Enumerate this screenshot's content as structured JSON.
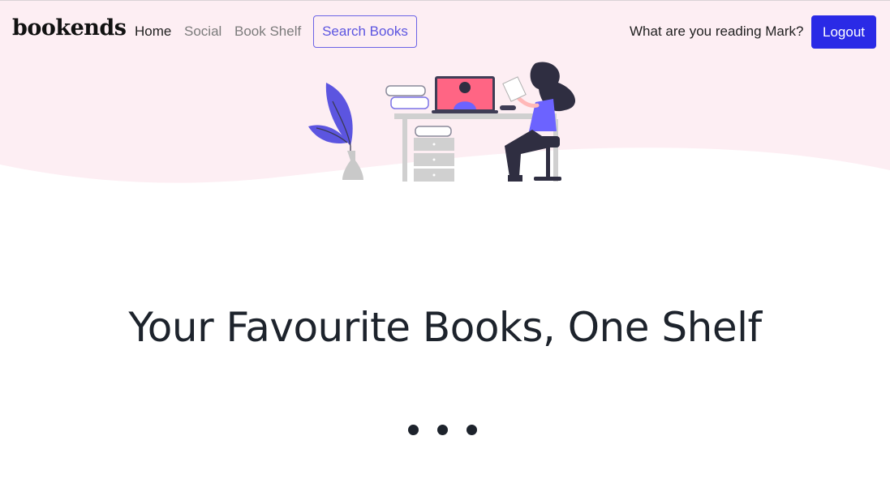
{
  "brand": {
    "name": "bookends"
  },
  "nav": {
    "items": [
      {
        "label": "Home",
        "active": true
      },
      {
        "label": "Social",
        "active": false
      },
      {
        "label": "Book Shelf",
        "active": false
      }
    ],
    "search_label": "Search Books",
    "greeting": "What are you reading Mark?",
    "logout_label": "Logout"
  },
  "hero": {
    "headline": "Your Favourite Books, One Shelf",
    "illustration_icon": "woman-reading-at-desk-illustration"
  },
  "loader": {
    "dots": 3
  },
  "colors": {
    "hero_bg": "#fdeef3",
    "accent": "#6c63ff",
    "logout_bg": "#2a2ae6",
    "text_dark": "#1d232c"
  }
}
